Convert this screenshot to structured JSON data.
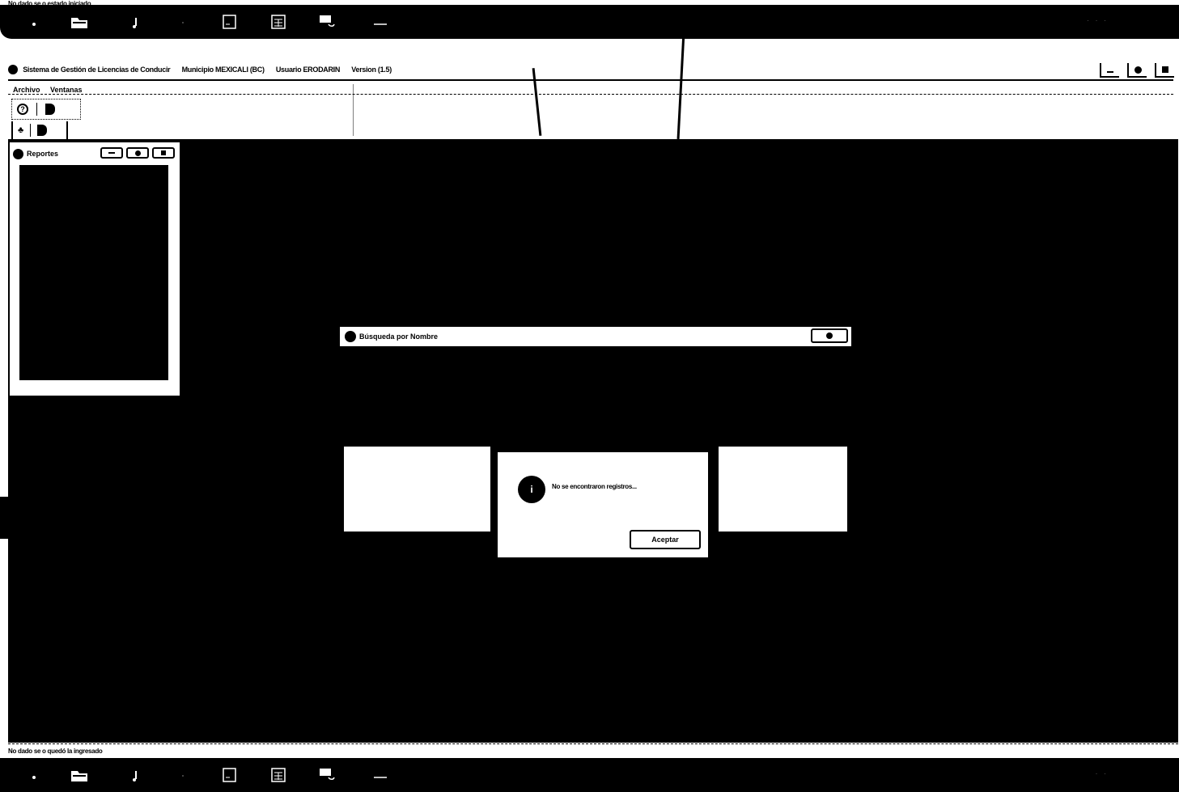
{
  "top_caption": "No dado se o estado iniciado",
  "window": {
    "app_title": "Sistema de Gestión de Licencias de Conducir",
    "municipio": "Municipio MEXICALI (BC)",
    "usuario": "Usuario ERODARIN",
    "version": "Version (1.5)"
  },
  "menu": [
    "Archivo",
    "Ventanas"
  ],
  "panel": {
    "title": "Reportes"
  },
  "inner_window": {
    "title": "Búsqueda por Nombre"
  },
  "dialog": {
    "icon": "i",
    "message": "No se encontraron registros...",
    "accept_label": "Aceptar"
  },
  "status_text": "No dado se o quedó la ingresado",
  "icons": {
    "taskbar": [
      "start-icon",
      "folder-icon",
      "music-icon",
      "blank-icon",
      "document-icon",
      "calculator-icon",
      "monitor-icon",
      "minus-icon"
    ],
    "toolbar": [
      "help-icon",
      "exit-icon",
      "users-icon",
      "exit-icon"
    ]
  },
  "colors": {
    "background": "#000000",
    "foreground": "#ffffff"
  }
}
